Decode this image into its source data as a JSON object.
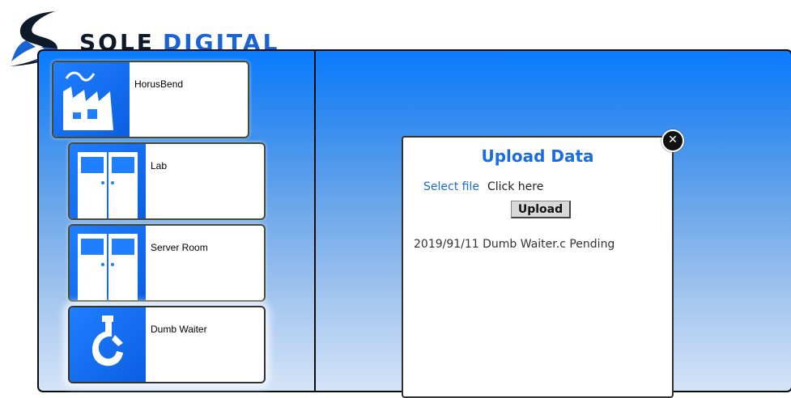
{
  "brand": {
    "word1": "SOLE",
    "word2": "DIGITAL",
    "logo_icon": "swoosh-s-logo"
  },
  "locations": [
    {
      "label": "HorusBend",
      "icon": "factory-icon"
    },
    {
      "label": "Lab",
      "icon": "double-door-icon"
    },
    {
      "label": "Server Room",
      "icon": "double-door-icon"
    },
    {
      "label": "Dumb Waiter",
      "icon": "crane-hook-icon",
      "selected": true
    }
  ],
  "modal": {
    "title": "Upload Data",
    "select_file_label": "Select file",
    "file_value": "Click here",
    "upload_label": "Upload",
    "status_line": "2019/91/11 Dumb Waiter.c Pending",
    "close_icon": "close-icon"
  },
  "colors": {
    "accent": "#1a6de0",
    "tile_blue": "#1f7fff",
    "frame_border": "#0b0b0b"
  }
}
